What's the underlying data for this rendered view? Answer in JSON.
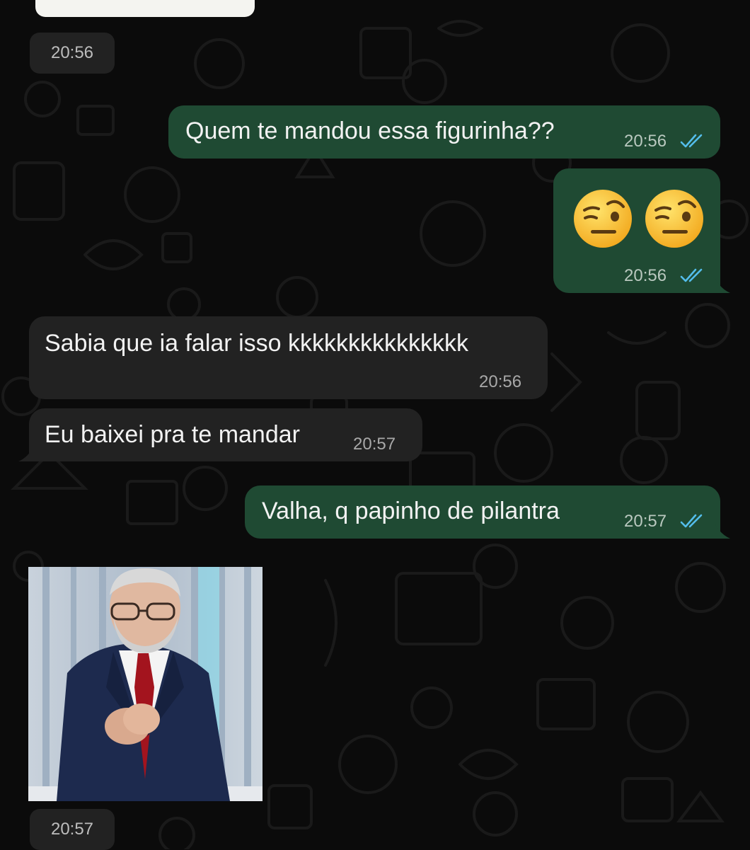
{
  "chat": {
    "messages": [
      {
        "direction": "received",
        "type": "sticker",
        "time": "20:56"
      },
      {
        "direction": "sent",
        "type": "text",
        "text": "Quem te mandou essa figurinha??",
        "time": "20:56",
        "status": "read"
      },
      {
        "direction": "sent",
        "type": "emoji",
        "emojis": [
          "face-with-raised-eyebrow",
          "face-with-raised-eyebrow"
        ],
        "time": "20:56",
        "status": "read"
      },
      {
        "direction": "received",
        "type": "text",
        "text": "Sabia que ia falar isso kkkkkkkkkkkkkkk",
        "time": "20:56"
      },
      {
        "direction": "received",
        "type": "text",
        "text": "Eu baixei pra te mandar",
        "time": "20:57"
      },
      {
        "direction": "sent",
        "type": "text",
        "text": "Valha, q papinho de pilantra",
        "time": "20:57",
        "status": "read"
      },
      {
        "direction": "received",
        "type": "sticker",
        "time": "20:57"
      }
    ]
  },
  "colors": {
    "background": "#0b0b0b",
    "outgoing_bubble": "#1f4a33",
    "incoming_bubble": "#222222",
    "read_ticks": "#53bdeb"
  }
}
